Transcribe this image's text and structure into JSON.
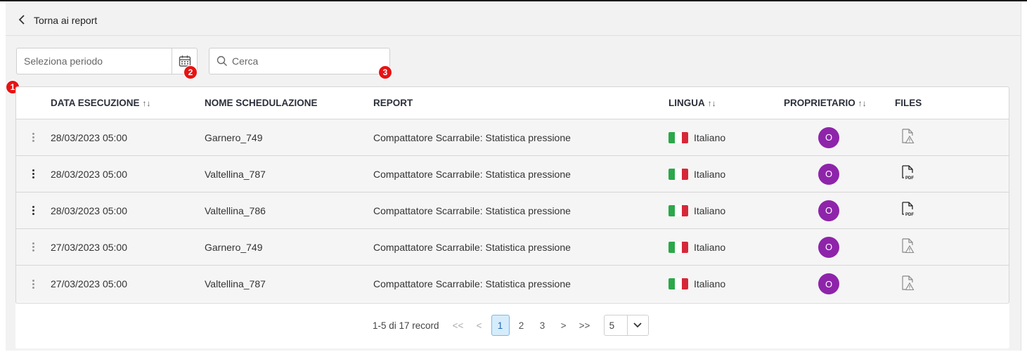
{
  "nav": {
    "back_label": "Torna ai report"
  },
  "filters": {
    "period_placeholder": "Seleziona periodo",
    "search_placeholder": "Cerca"
  },
  "badges": [
    "1",
    "2",
    "3"
  ],
  "table": {
    "columns": {
      "date": "DATA ESECUZIONE",
      "name": "NOME SCHEDULAZIONE",
      "report": "REPORT",
      "language": "LINGUA",
      "owner": "PROPRIETARIO",
      "files": "FILES"
    },
    "sort_glyph": "↑↓",
    "rows": [
      {
        "date": "28/03/2023 05:00",
        "name": "Garnero_749",
        "report": "Compattatore Scarrabile: Statistica pressione",
        "language": "Italiano",
        "owner_initial": "O",
        "file_icon": "file-warning-icon",
        "menu_active": false
      },
      {
        "date": "28/03/2023 05:00",
        "name": "Valtellina_787",
        "report": "Compattatore Scarrabile: Statistica pressione",
        "language": "Italiano",
        "owner_initial": "O",
        "file_icon": "pdf-file-icon",
        "menu_active": true
      },
      {
        "date": "28/03/2023 05:00",
        "name": "Valtellina_786",
        "report": "Compattatore Scarrabile: Statistica pressione",
        "language": "Italiano",
        "owner_initial": "O",
        "file_icon": "pdf-file-icon",
        "menu_active": true
      },
      {
        "date": "27/03/2023 05:00",
        "name": "Garnero_749",
        "report": "Compattatore Scarrabile: Statistica pressione",
        "language": "Italiano",
        "owner_initial": "O",
        "file_icon": "file-warning-icon",
        "menu_active": false
      },
      {
        "date": "27/03/2023 05:00",
        "name": "Valtellina_787",
        "report": "Compattatore Scarrabile: Statistica pressione",
        "language": "Italiano",
        "owner_initial": "O",
        "file_icon": "file-warning-icon",
        "menu_active": false
      }
    ]
  },
  "pagination": {
    "info": "1-5 di 17 record",
    "first": "<<",
    "prev": "<",
    "pages": [
      "1",
      "2",
      "3"
    ],
    "current_page": "1",
    "next": ">",
    "last": ">>",
    "page_size": "5"
  },
  "colors": {
    "avatar": "#8e24aa",
    "badge": "#e81313",
    "active_page_bg": "#d6ecfa"
  }
}
